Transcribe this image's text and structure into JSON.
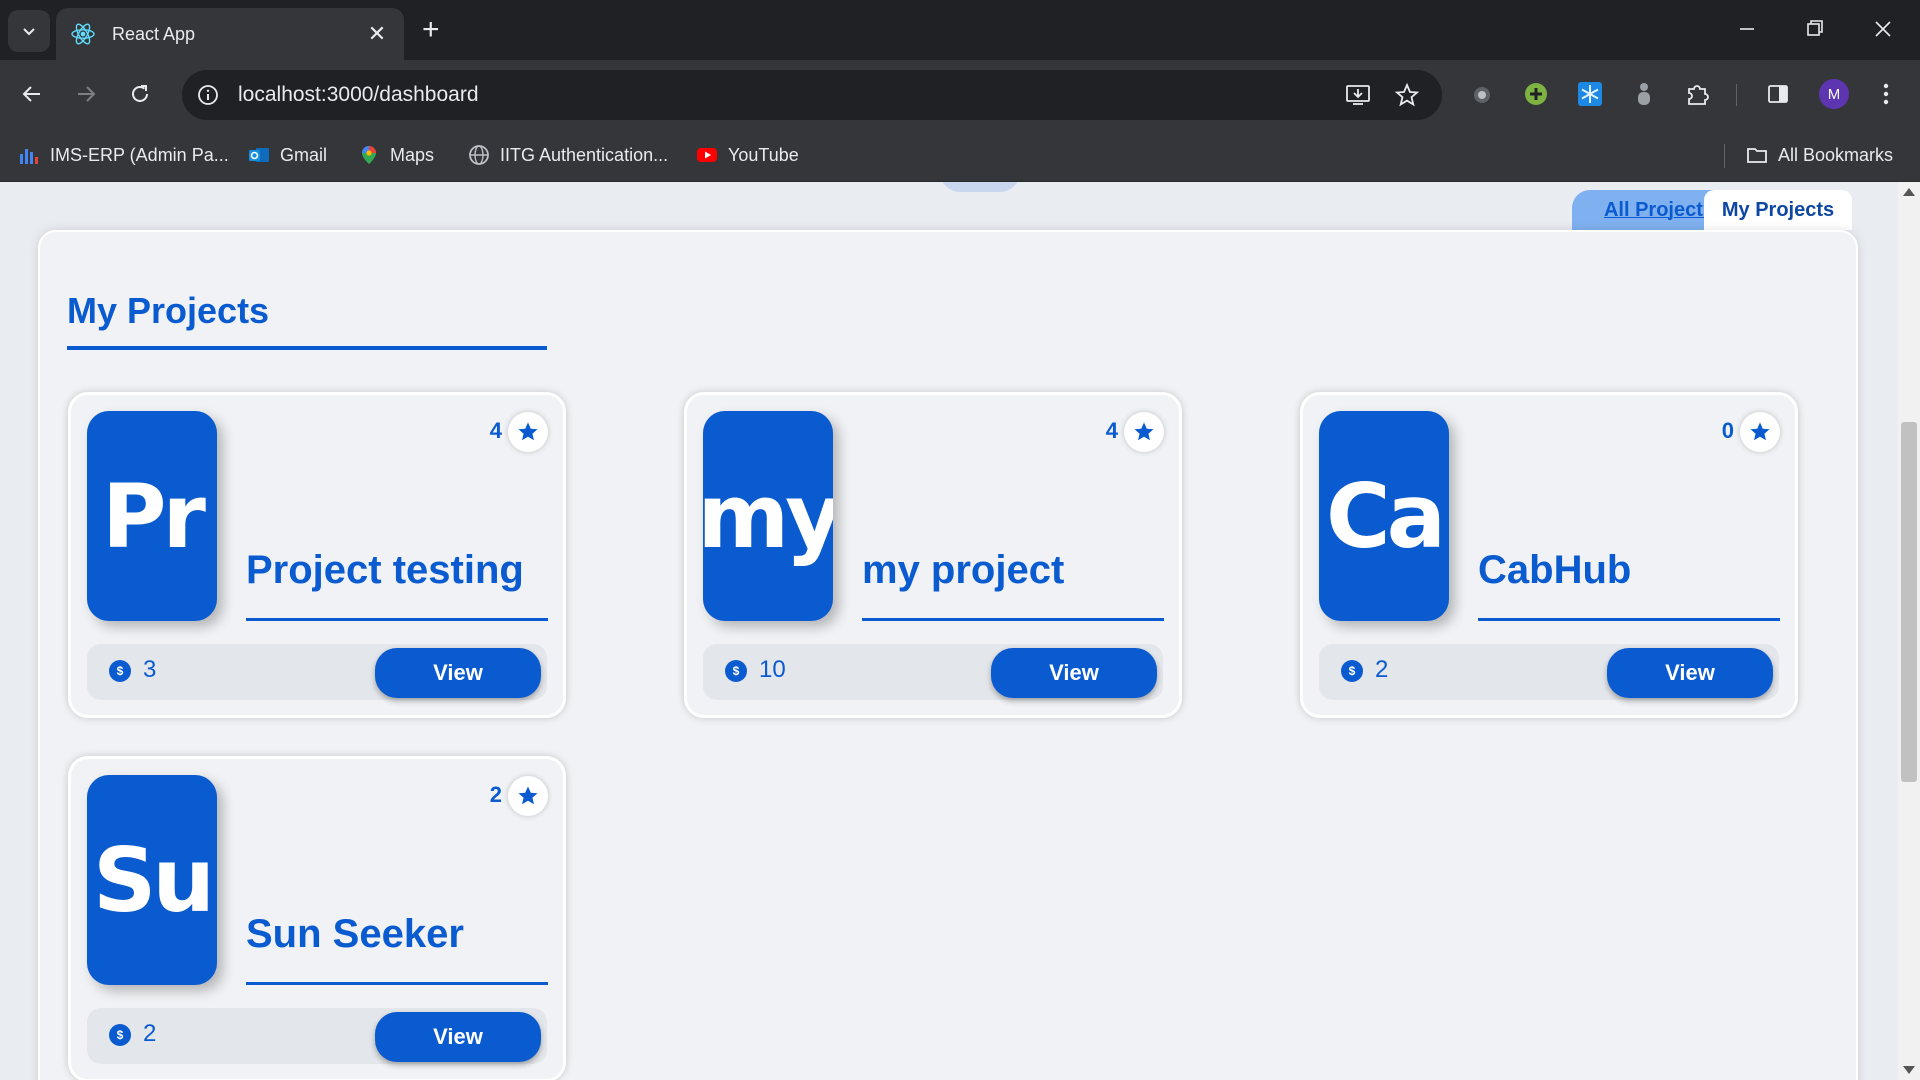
{
  "browser": {
    "tab_title": "React App",
    "url": "localhost:3000/dashboard",
    "profile_initial": "M",
    "bookmarks": [
      {
        "label": "IMS-ERP (Admin Pa...",
        "icon": "bar-chart-icon"
      },
      {
        "label": "Gmail",
        "icon": "outlook-icon"
      },
      {
        "label": "Maps",
        "icon": "maps-pin-icon"
      },
      {
        "label": "IITG Authentication...",
        "icon": "globe-icon"
      },
      {
        "label": "YouTube",
        "icon": "youtube-icon"
      }
    ],
    "all_bookmarks_label": "All Bookmarks"
  },
  "tabs": {
    "all_projects": "All Projects",
    "my_projects": "My Projects"
  },
  "section": {
    "title": "My Projects"
  },
  "projects": [
    {
      "initials": "Pr",
      "name": "Project testing",
      "stars": "4",
      "coins": "3",
      "view_label": "View"
    },
    {
      "initials": "my",
      "name": "my project",
      "stars": "4",
      "coins": "10",
      "view_label": "View"
    },
    {
      "initials": "Ca",
      "name": "CabHub",
      "stars": "0",
      "coins": "2",
      "view_label": "View"
    },
    {
      "initials": "Su",
      "name": "Sun Seeker",
      "stars": "2",
      "coins": "2",
      "view_label": "View"
    }
  ],
  "colors": {
    "accent": "#0b5bd0",
    "chrome_dark": "#202124",
    "chrome_mid": "#35363a"
  }
}
